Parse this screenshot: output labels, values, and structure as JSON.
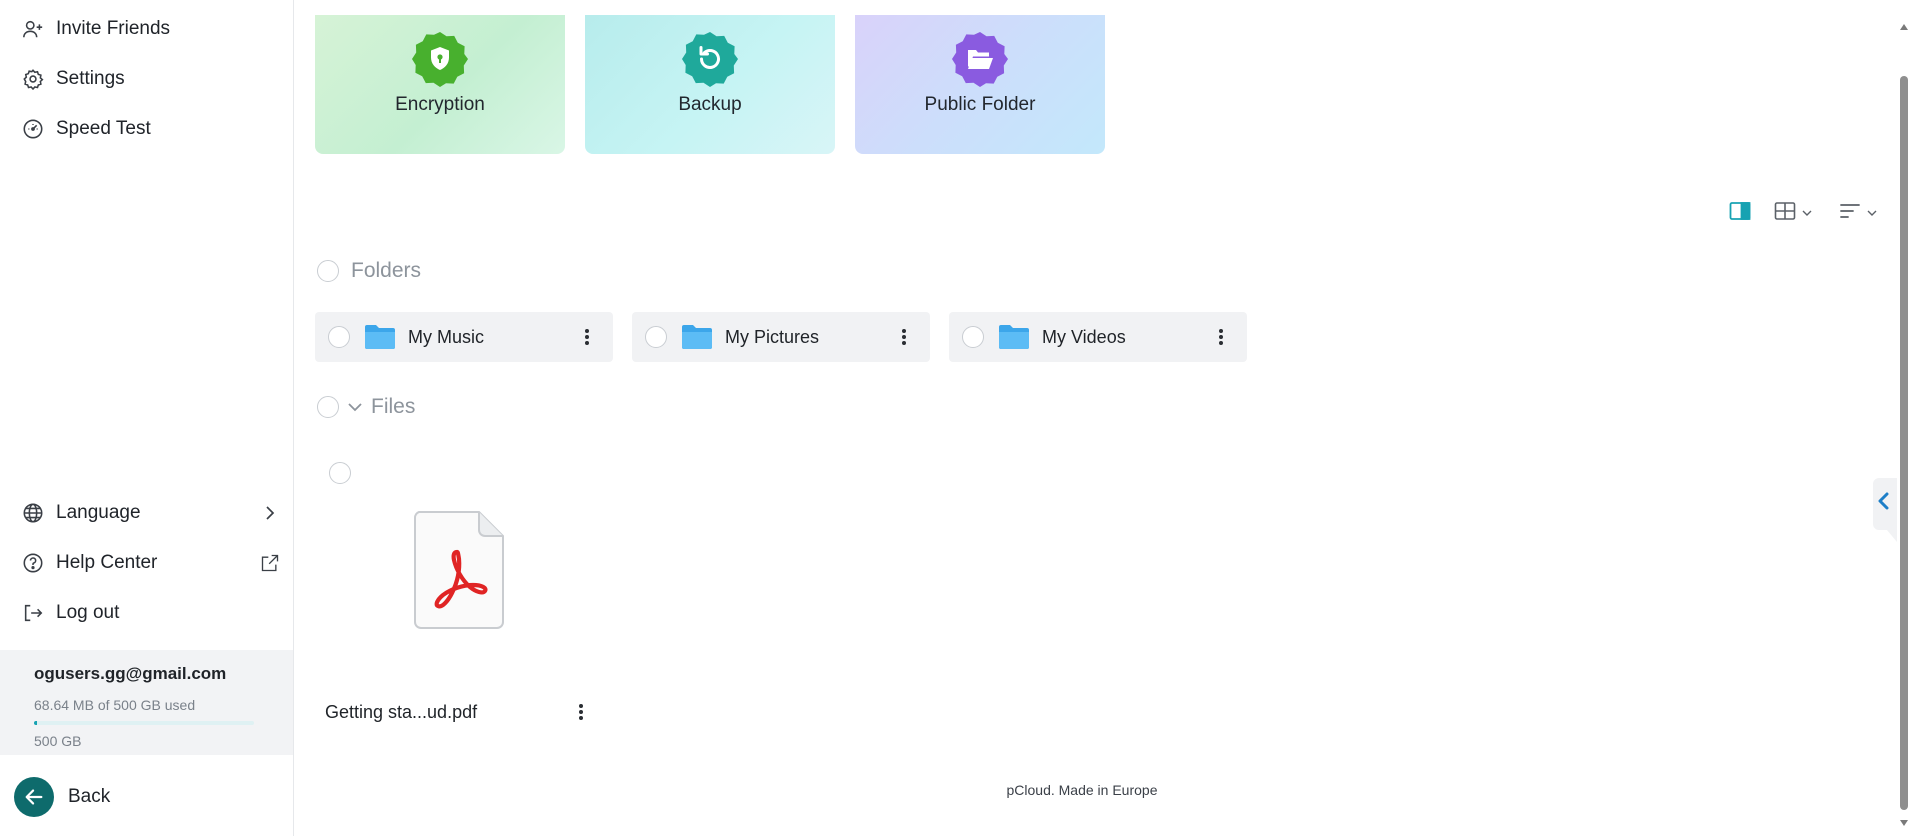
{
  "sidebar": {
    "items_top": [
      {
        "label": "Invite Friends",
        "icon": "add-user-icon"
      },
      {
        "label": "Settings",
        "icon": "gear-icon"
      },
      {
        "label": "Speed Test",
        "icon": "speedometer-icon"
      }
    ],
    "items_bottom": [
      {
        "label": "Language",
        "icon": "globe-icon",
        "right_icon": "chevron-right-icon"
      },
      {
        "label": "Help Center",
        "icon": "help-icon",
        "right_icon": "external-link-icon"
      },
      {
        "label": "Log out",
        "icon": "logout-icon"
      }
    ],
    "account": {
      "email": "ogusers.gg@gmail.com",
      "usage": "68.64 MB of 500 GB used",
      "usage_fraction": 0.0134,
      "total": "500 GB"
    },
    "back_label": "Back"
  },
  "features": [
    {
      "label": "Encryption",
      "icon": "shield-lock-icon",
      "color": "#48b02e"
    },
    {
      "label": "Backup",
      "icon": "backup-refresh-icon",
      "color": "#1fa99b"
    },
    {
      "label": "Public Folder",
      "icon": "open-folder-icon",
      "color": "#8a5be0"
    }
  ],
  "sections": {
    "folders_title": "Folders",
    "files_title": "Files"
  },
  "folders": [
    {
      "name": "My Music"
    },
    {
      "name": "My Pictures"
    },
    {
      "name": "My Videos"
    }
  ],
  "files": [
    {
      "name": "Getting sta...ud.pdf",
      "type": "pdf"
    }
  ],
  "footer": "pCloud. Made in Europe",
  "colors": {
    "accent": "#17a2b2",
    "brand_dark": "#0e6b6c",
    "folder_blue": "#4fb3f0"
  }
}
